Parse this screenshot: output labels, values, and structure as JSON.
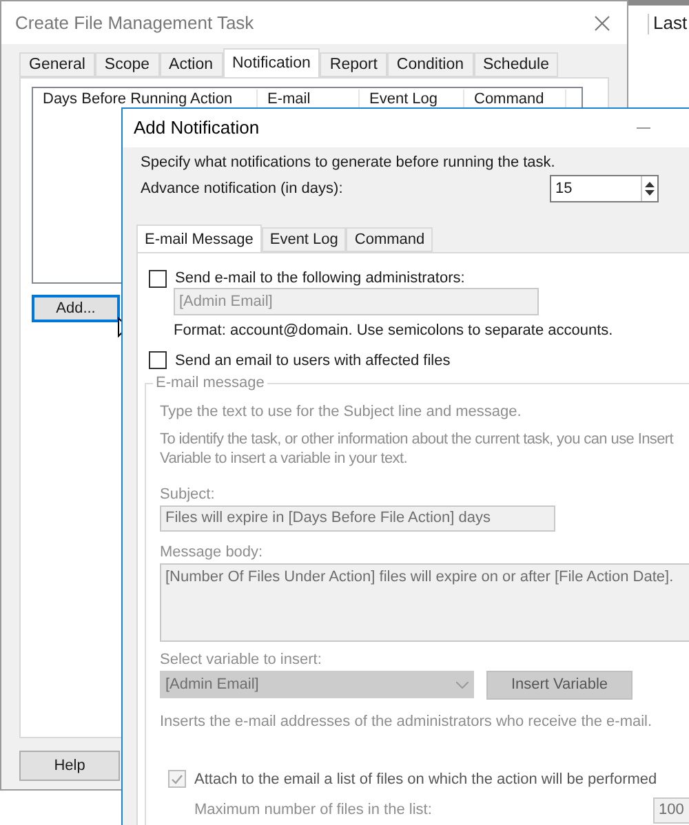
{
  "background_window": {
    "column_header": "Last"
  },
  "main_window": {
    "title": "Create File Management Task",
    "tabs": [
      {
        "label": "General",
        "selected": false
      },
      {
        "label": "Scope",
        "selected": false
      },
      {
        "label": "Action",
        "selected": false
      },
      {
        "label": "Notification",
        "selected": true
      },
      {
        "label": "Report",
        "selected": false
      },
      {
        "label": "Condition",
        "selected": false
      },
      {
        "label": "Schedule",
        "selected": false
      }
    ],
    "list_columns": [
      "Days Before Running Action",
      "E-mail",
      "Event Log",
      "Command"
    ],
    "add_button": "Add...",
    "help_button": "Help"
  },
  "dialog": {
    "title": "Add Notification",
    "description": "Specify what notifications to generate before running the task.",
    "advance_label": "Advance notification (in days):",
    "advance_value": "15",
    "tabs": [
      {
        "label": "E-mail Message",
        "selected": true
      },
      {
        "label": "Event Log",
        "selected": false
      },
      {
        "label": "Command",
        "selected": false
      }
    ],
    "send_admins": {
      "label": "Send e-mail to the following administrators:",
      "checked": false
    },
    "admin_email": {
      "value": "[Admin Email]",
      "disabled": true
    },
    "format_hint": "Format: account@domain. Use semicolons to separate accounts.",
    "send_users": {
      "label": "Send an email to users with affected files",
      "checked": false
    },
    "group": {
      "legend": "E-mail message",
      "disabled": true,
      "intro": "Type the text to use for the Subject line and message.",
      "info": "To identify the task, or other information about the current task, you can use Insert\nVariable to insert a variable in your text.",
      "subject_label": "Subject:",
      "subject_value": "Files will expire in [Days Before File Action] days",
      "body_label": "Message body:",
      "body_value": "[Number Of Files Under Action] files will expire on or after [File Action Date].",
      "variable_label": "Select variable to insert:",
      "variable_value": "[Admin Email]",
      "insert_button": "Insert Variable",
      "variable_hint": "Inserts the e-mail addresses of the administrators who receive the e-mail."
    },
    "attach": {
      "label": "Attach to the email a list of files on which the action will be performed",
      "checked": true,
      "disabled": true
    },
    "max_label": "Maximum number of files in the list:",
    "max_value": "100"
  }
}
